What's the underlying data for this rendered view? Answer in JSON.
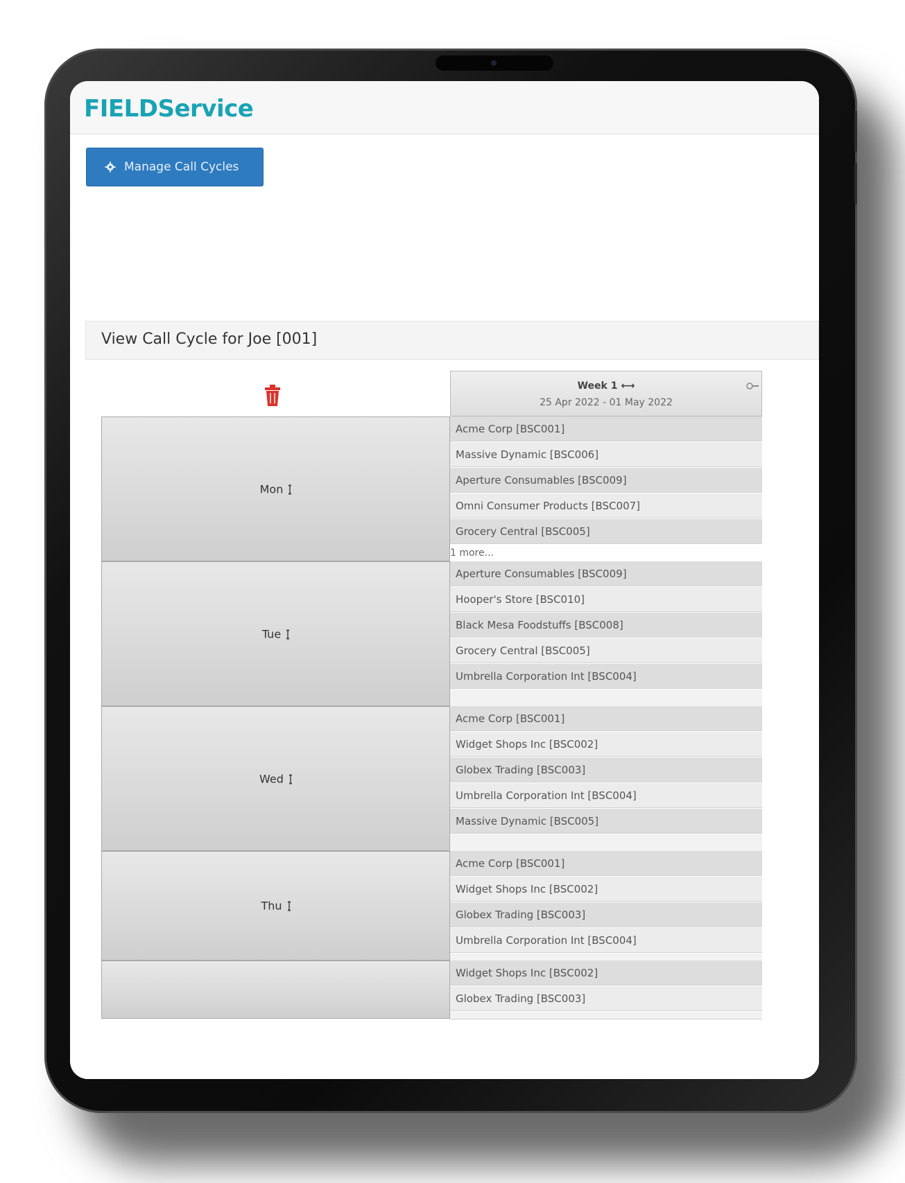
{
  "brand": {
    "name": "FIELDService",
    "color": "#1aa3b4"
  },
  "toolbar": {
    "manage_label": "Manage Call Cycles",
    "icon": "gear-icon"
  },
  "panel": {
    "title": "View Call Cycle for Joe [001]"
  },
  "week": {
    "label": "Week 1 ⟷",
    "dates": "25 Apr 2022 - 01 May 2022"
  },
  "days": [
    {
      "name": "Mon",
      "customers": [
        "Acme Corp [BSC001]",
        "Massive Dynamic [BSC006]",
        "Aperture Consumables [BSC009]",
        "Omni Consumer Products [BSC007]",
        "Grocery Central [BSC005]"
      ],
      "more": "1 more..."
    },
    {
      "name": "Tue",
      "customers": [
        "Aperture Consumables [BSC009]",
        "Hooper's Store [BSC010]",
        "Black Mesa Foodstuffs [BSC008]",
        "Grocery Central [BSC005]",
        "Umbrella Corporation Int [BSC004]"
      ]
    },
    {
      "name": "Wed",
      "customers": [
        "Acme Corp [BSC001]",
        "Widget Shops Inc [BSC002]",
        "Globex Trading [BSC003]",
        "Umbrella Corporation Int [BSC004]",
        "Massive Dynamic [BSC005]"
      ]
    },
    {
      "name": "Thu",
      "customers": [
        "Acme Corp [BSC001]",
        "Widget Shops Inc [BSC002]",
        "Globex Trading [BSC003]",
        "Umbrella Corporation Int [BSC004]"
      ]
    },
    {
      "name": "",
      "customers": [
        "Widget Shops Inc [BSC002]",
        "Globex Trading [BSC003]"
      ]
    }
  ],
  "colors": {
    "button": "#2f7bbf",
    "trash": "#d9332b",
    "accent": "#1aa3b4"
  }
}
